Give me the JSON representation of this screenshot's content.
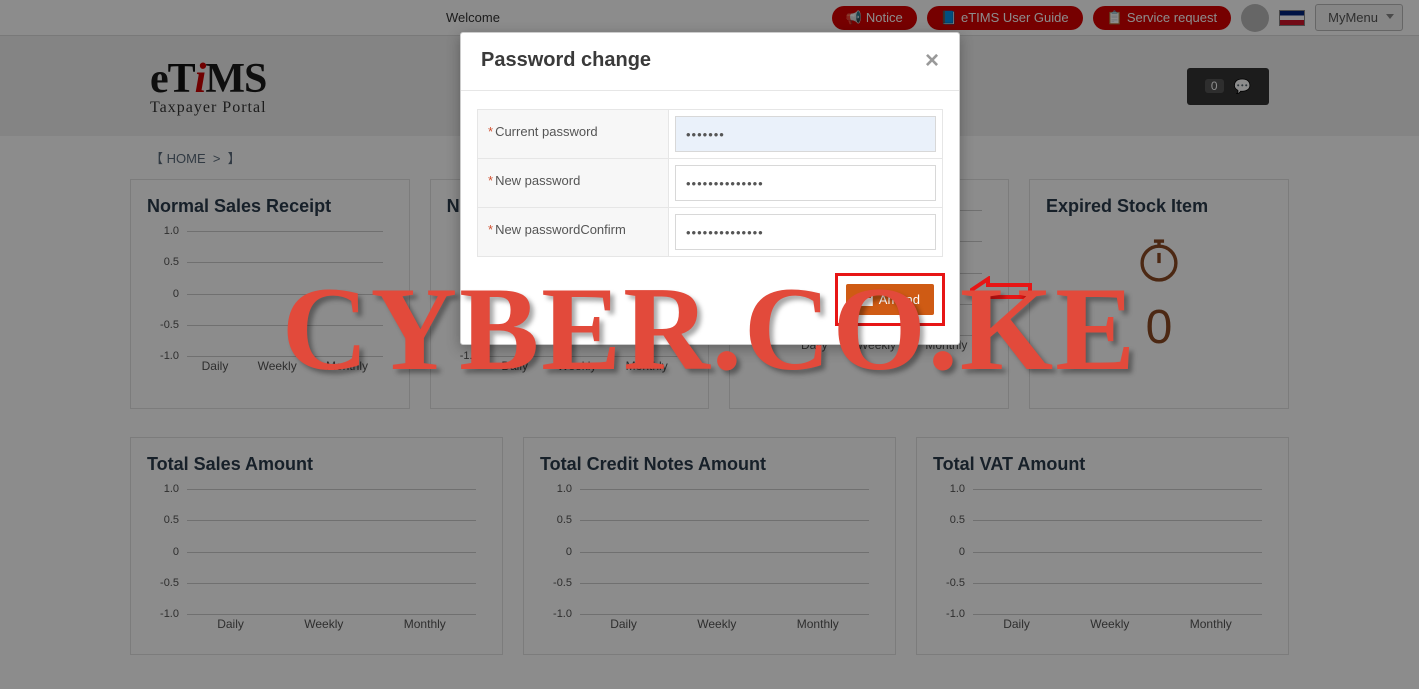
{
  "topbar": {
    "welcome": "Welcome",
    "notice": "Notice",
    "guide": "eTIMS User Guide",
    "service": "Service request",
    "mymenu": "MyMenu"
  },
  "header": {
    "logo_main": "eTiMS",
    "logo_sub": "Taxpayer Portal",
    "msg_count": "0"
  },
  "breadcrumb": {
    "home": "HOME"
  },
  "cards": {
    "row1": [
      "Normal Sales Receipt",
      "Norr",
      "",
      "Expired Stock Item"
    ],
    "row2": [
      "Total Sales Amount",
      "Total Credit Notes Amount",
      "Total VAT Amount"
    ],
    "expired_count": "0"
  },
  "chart": {
    "yticks": [
      "1.0",
      "0.5",
      "0",
      "-0.5",
      "-1.0"
    ],
    "xticks": [
      "Daily",
      "Weekly",
      "Monthly"
    ]
  },
  "modal": {
    "title": "Password change",
    "fields": {
      "current_label": "Current password",
      "current_value": "•••••••",
      "new_label": "New password",
      "new_value": "••••••••••••••",
      "confirm_label": "New passwordConfirm",
      "confirm_value": "••••••••••••••"
    },
    "amend": "Amend"
  },
  "watermark": "CYBER.CO.KE",
  "chart_data": [
    {
      "type": "bar",
      "title": "Normal Sales Receipt",
      "categories": [
        "Daily",
        "Weekly",
        "Monthly"
      ],
      "values": [
        0,
        0,
        0
      ],
      "ylim": [
        -1,
        1
      ]
    },
    {
      "type": "bar",
      "title": "Total Sales Amount",
      "categories": [
        "Daily",
        "Weekly",
        "Monthly"
      ],
      "values": [
        0,
        0,
        0
      ],
      "ylim": [
        -1,
        1
      ]
    },
    {
      "type": "bar",
      "title": "Total Credit Notes Amount",
      "categories": [
        "Daily",
        "Weekly",
        "Monthly"
      ],
      "values": [
        0,
        0,
        0
      ],
      "ylim": [
        -1,
        1
      ]
    },
    {
      "type": "bar",
      "title": "Total VAT Amount",
      "categories": [
        "Daily",
        "Weekly",
        "Monthly"
      ],
      "values": [
        0,
        0,
        0
      ],
      "ylim": [
        -1,
        1
      ]
    }
  ]
}
